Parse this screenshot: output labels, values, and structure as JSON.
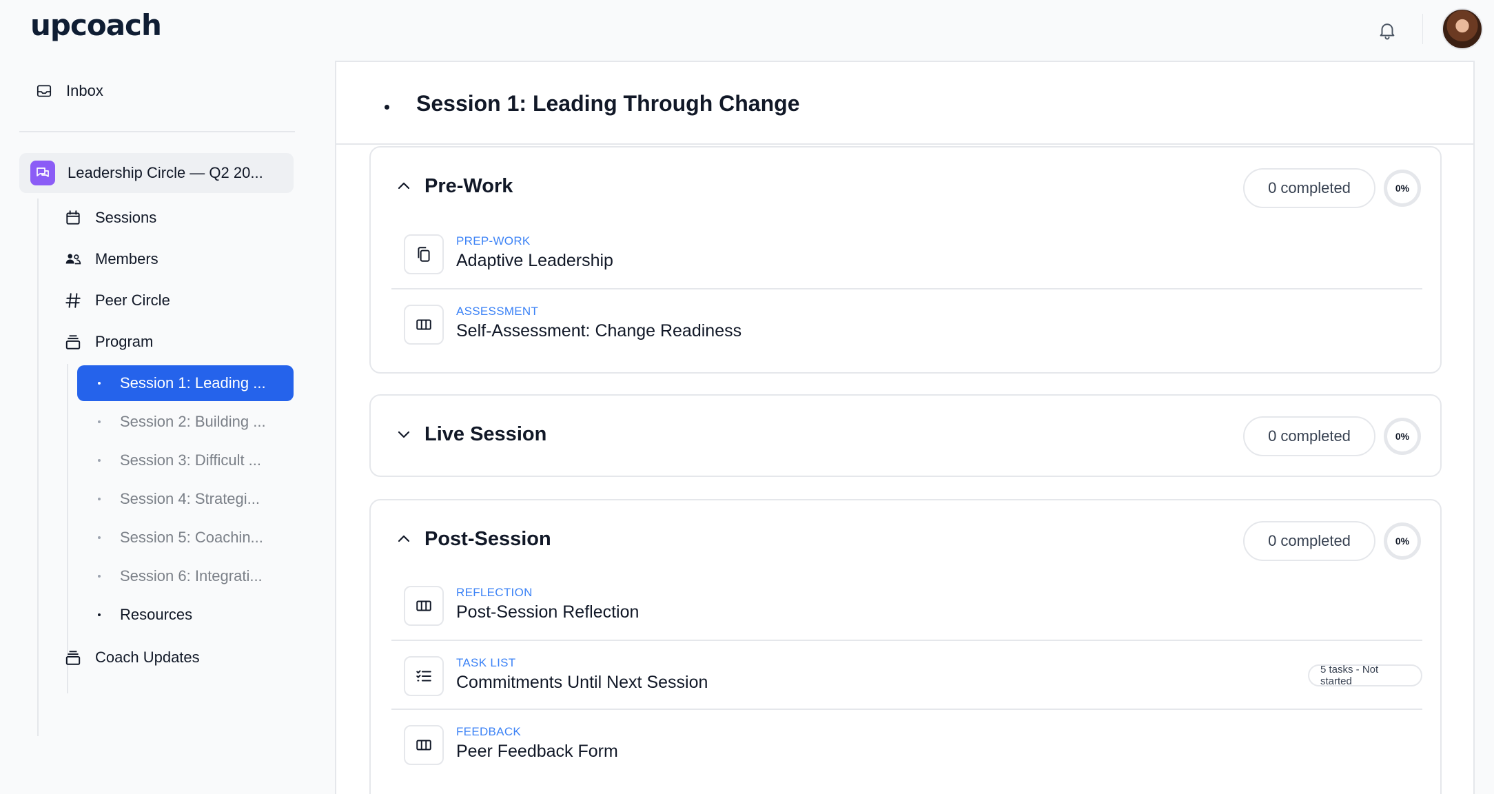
{
  "app": {
    "logo": "upcoach"
  },
  "sidebar": {
    "inbox": "Inbox",
    "course": "Leadership Circle — Q2 20...",
    "nav": {
      "sessions": "Sessions",
      "members": "Members",
      "peer_circle": "Peer Circle",
      "program": "Program",
      "coach_updates": "Coach Updates"
    },
    "program_items": [
      {
        "label": "Session 1: Leading ...",
        "active": true
      },
      {
        "label": "Session 2: Building ..."
      },
      {
        "label": "Session 3: Difficult ..."
      },
      {
        "label": "Session 4: Strategi..."
      },
      {
        "label": "Session 5: Coachin..."
      },
      {
        "label": "Session 6: Integrati..."
      },
      {
        "label": "Resources"
      }
    ]
  },
  "main": {
    "title": "Session 1: Leading Through Change",
    "sections": [
      {
        "title": "Pre-Work",
        "completed": "0 completed",
        "percent": "0%",
        "expanded": true,
        "items": [
          {
            "kind": "PREP-WORK",
            "name": "Adaptive Leadership",
            "icon": "copy-icon"
          },
          {
            "kind": "ASSESSMENT",
            "name": "Self-Assessment: Change Readiness",
            "icon": "columns-icon"
          }
        ]
      },
      {
        "title": "Live Session",
        "completed": "0 completed",
        "percent": "0%",
        "expanded": false
      },
      {
        "title": "Post-Session",
        "completed": "0 completed",
        "percent": "0%",
        "expanded": true,
        "items": [
          {
            "kind": "REFLECTION",
            "name": "Post-Session Reflection",
            "icon": "columns-icon"
          },
          {
            "kind": "TASK LIST",
            "name": "Commitments Until Next Session",
            "icon": "checklist-icon",
            "badge": "5 tasks - Not started"
          },
          {
            "kind": "FEEDBACK",
            "name": "Peer Feedback Form",
            "icon": "columns-icon"
          }
        ]
      }
    ]
  },
  "colors": {
    "accent": "#2563eb",
    "item_kind": "#3b82f6",
    "course_icon": "#8b5cf6"
  }
}
